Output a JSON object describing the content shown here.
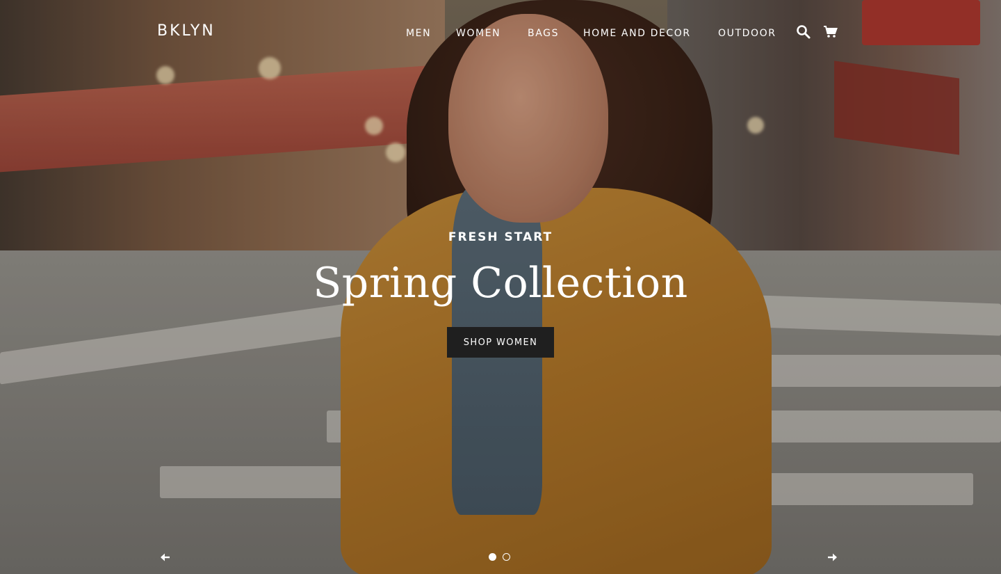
{
  "header": {
    "logo": "BKLYN",
    "nav": [
      {
        "label": "MEN"
      },
      {
        "label": "WOMEN"
      },
      {
        "label": "BAGS"
      },
      {
        "label": "HOME AND DECOR"
      },
      {
        "label": "OUTDOOR"
      }
    ],
    "icons": {
      "search": "search-icon",
      "cart": "cart-icon"
    }
  },
  "hero": {
    "eyebrow": "FRESH START",
    "headline": "Spring Collection",
    "cta_label": "SHOP WOMEN"
  },
  "slider": {
    "prev_icon": "arrow-left-icon",
    "next_icon": "arrow-right-icon",
    "slide_count": 2,
    "active_slide": 1
  },
  "colors": {
    "text": "#ffffff",
    "cta_background": "#1f1f1f",
    "jacket_mustard": "#b67a2a"
  }
}
